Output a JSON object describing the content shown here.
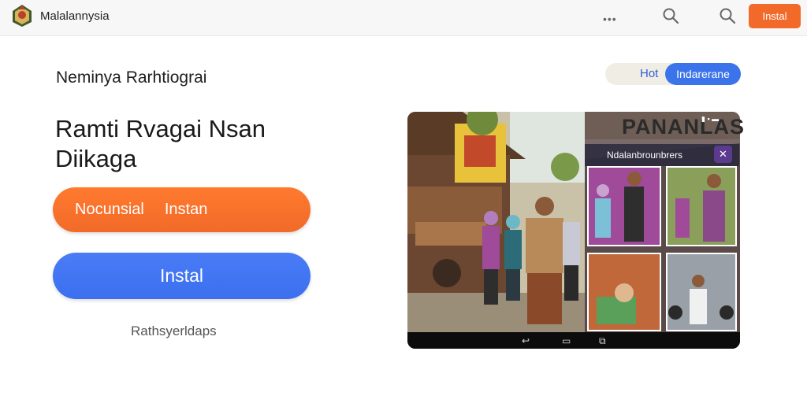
{
  "header": {
    "app_name": "Malalannysia",
    "more_icon": "more-dots-icon",
    "search_icon": "search-icon",
    "action_button": "Instal"
  },
  "hero": {
    "subtitle": "Neminya Rarhtiograi",
    "headline_line1": "Ramti Rvagai Nsan",
    "headline_line2": "Diikaga",
    "primary_button_part1": "Nocunsial",
    "primary_button_part2": "Instan",
    "secondary_button": "Instal",
    "footer_link": "Rathsyerldaps"
  },
  "toggle": {
    "left_label": "Hot",
    "right_label": "Indarerane"
  },
  "preview": {
    "overlay_title": "PANANLAS",
    "panel_header": "Ndalanbrounbrers",
    "panel_close_icon": "x-icon",
    "nav_icons": [
      "back-icon",
      "home-icon",
      "recents-icon"
    ]
  },
  "colors": {
    "accent_orange": "#f26a2a",
    "accent_blue": "#3b74ea"
  }
}
